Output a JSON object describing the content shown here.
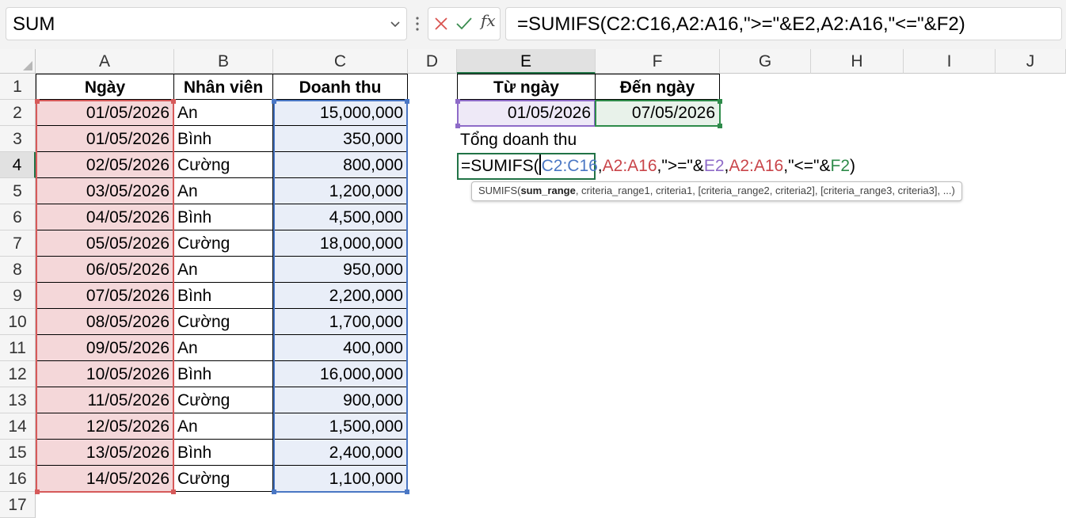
{
  "name_box": {
    "value": "SUM"
  },
  "formula_bar": {
    "formula": "=SUMIFS(C2:C16,A2:A16,\">=\"&E2,A2:A16,\"<=\"&F2)"
  },
  "columns": [
    "A",
    "B",
    "C",
    "D",
    "E",
    "F",
    "G",
    "H",
    "I",
    "J"
  ],
  "rows": [
    "1",
    "2",
    "3",
    "4",
    "5",
    "6",
    "7",
    "8",
    "9",
    "10",
    "11",
    "12",
    "13",
    "14",
    "15",
    "16",
    "17"
  ],
  "table": {
    "headers": {
      "a": "Ngày",
      "b": "Nhân viên",
      "c": "Doanh thu"
    },
    "data": [
      {
        "date": "01/05/2026",
        "name": "An",
        "revenue": "15,000,000"
      },
      {
        "date": "01/05/2026",
        "name": "Bình",
        "revenue": "350,000"
      },
      {
        "date": "02/05/2026",
        "name": "Cường",
        "revenue": "800,000"
      },
      {
        "date": "03/05/2026",
        "name": "An",
        "revenue": "1,200,000"
      },
      {
        "date": "04/05/2026",
        "name": "Bình",
        "revenue": "4,500,000"
      },
      {
        "date": "05/05/2026",
        "name": "Cường",
        "revenue": "18,000,000"
      },
      {
        "date": "06/05/2026",
        "name": "An",
        "revenue": "950,000"
      },
      {
        "date": "07/05/2026",
        "name": "Bình",
        "revenue": "2,200,000"
      },
      {
        "date": "08/05/2026",
        "name": "Cường",
        "revenue": "1,700,000"
      },
      {
        "date": "09/05/2026",
        "name": "An",
        "revenue": "400,000"
      },
      {
        "date": "10/05/2026",
        "name": "Bình",
        "revenue": "16,000,000"
      },
      {
        "date": "11/05/2026",
        "name": "Cường",
        "revenue": "900,000"
      },
      {
        "date": "12/05/2026",
        "name": "An",
        "revenue": "1,500,000"
      },
      {
        "date": "13/05/2026",
        "name": "Bình",
        "revenue": "2,400,000"
      },
      {
        "date": "14/05/2026",
        "name": "Cường",
        "revenue": "1,100,000"
      }
    ]
  },
  "criteria": {
    "from_label": "Từ ngày",
    "to_label": "Đến ngày",
    "from_value": "01/05/2026",
    "to_value": "07/05/2026",
    "total_label": "Tổng doanh thu"
  },
  "cell_edit": {
    "parts": [
      "=SUMIFS(",
      "C2:C16",
      ",",
      "A2:A16",
      ",\">=\"&",
      "E2",
      ",",
      "A2:A16",
      ",\"<=\"&",
      "F2",
      ")"
    ]
  },
  "tooltip": {
    "func": "SUMIFS(",
    "arg_bold": "sum_range",
    "rest": ", criteria_range1, criteria1, [criteria_range2, criteria2], [criteria_range3, criteria3], ...)"
  },
  "colors": {
    "range_a": "#d65a5a",
    "range_c": "#4a77c4",
    "range_e": "#8e6bc8",
    "range_f": "#2e8b4a",
    "selection": "#217346"
  }
}
